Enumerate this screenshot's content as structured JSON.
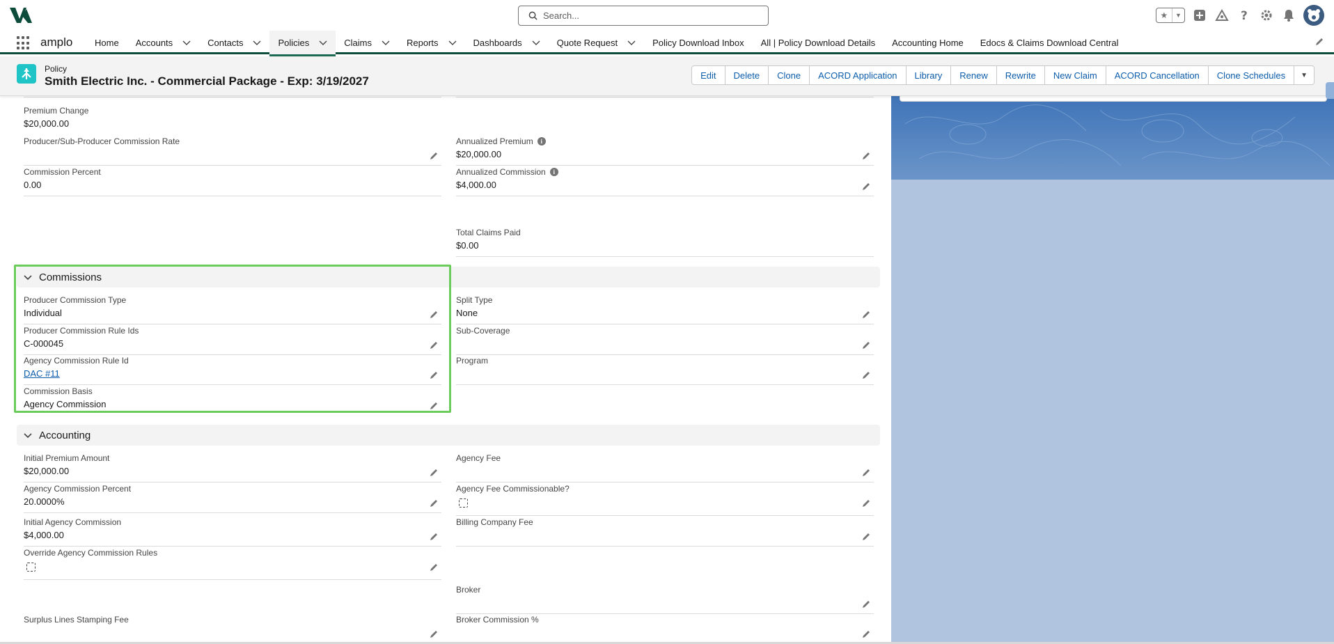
{
  "global_header": {
    "search_placeholder": "Search..."
  },
  "app": {
    "name": "amplo"
  },
  "nav": {
    "items": [
      {
        "label": "Home",
        "has_menu": false
      },
      {
        "label": "Accounts",
        "has_menu": true
      },
      {
        "label": "Contacts",
        "has_menu": true
      },
      {
        "label": "Policies",
        "has_menu": true,
        "active": true
      },
      {
        "label": "Claims",
        "has_menu": true
      },
      {
        "label": "Reports",
        "has_menu": true
      },
      {
        "label": "Dashboards",
        "has_menu": true
      },
      {
        "label": "Quote Request",
        "has_menu": true
      },
      {
        "label": "Policy Download Inbox",
        "has_menu": false
      },
      {
        "label": "All | Policy Download Details",
        "has_menu": false
      },
      {
        "label": "Accounting Home",
        "has_menu": false
      },
      {
        "label": "Edocs & Claims Download Central",
        "has_menu": false
      }
    ]
  },
  "record": {
    "type": "Policy",
    "title": "Smith Electric Inc. - Commercial Package - Exp: 3/19/2027"
  },
  "actions": [
    "Edit",
    "Delete",
    "Clone",
    "ACORD Application",
    "Library",
    "Renew",
    "Rewrite",
    "New Claim",
    "ACORD Cancellation",
    "Clone Schedules"
  ],
  "top_fields": {
    "premium_change": {
      "label": "Premium Change",
      "value": "$20,000.00"
    },
    "producer_rate": {
      "label": "Producer/Sub-Producer Commission Rate",
      "value": ""
    },
    "annualized_premium": {
      "label": "Annualized Premium",
      "value": "$20,000.00"
    },
    "commission_percent": {
      "label": "Commission Percent",
      "value": "0.00"
    },
    "annualized_commission": {
      "label": "Annualized Commission",
      "value": "$4,000.00"
    },
    "total_claims_paid": {
      "label": "Total Claims Paid",
      "value": "$0.00"
    }
  },
  "commissions": {
    "title": "Commissions",
    "producer_commission_type": {
      "label": "Producer Commission Type",
      "value": "Individual"
    },
    "split_type": {
      "label": "Split Type",
      "value": "None"
    },
    "producer_rule_ids": {
      "label": "Producer Commission Rule Ids",
      "value": "C-000045"
    },
    "sub_coverage": {
      "label": "Sub-Coverage",
      "value": ""
    },
    "agency_rule_id": {
      "label": "Agency Commission Rule Id",
      "value": "DAC #11"
    },
    "program": {
      "label": "Program",
      "value": ""
    },
    "commission_basis": {
      "label": "Commission Basis",
      "value": "Agency Commission"
    }
  },
  "accounting": {
    "title": "Accounting",
    "initial_premium": {
      "label": "Initial Premium Amount",
      "value": "$20,000.00"
    },
    "agency_fee": {
      "label": "Agency Fee",
      "value": ""
    },
    "agency_commission_percent": {
      "label": "Agency Commission Percent",
      "value": "20.0000%"
    },
    "agency_fee_commissionable": {
      "label": "Agency Fee Commissionable?",
      "checked": false
    },
    "initial_agency_commission": {
      "label": "Initial Agency Commission",
      "value": "$4,000.00"
    },
    "billing_company_fee": {
      "label": "Billing Company Fee",
      "value": ""
    },
    "override_rules": {
      "label": "Override Agency Commission Rules",
      "checked": false
    },
    "broker": {
      "label": "Broker",
      "value": ""
    },
    "surplus_stamping_fee": {
      "label": "Surplus Lines Stamping Fee",
      "value": ""
    },
    "broker_commission": {
      "label": "Broker Commission %",
      "value": ""
    }
  },
  "colors": {
    "brand_dark": "#0d4c3a",
    "link_blue": "#0b5cab",
    "highlight_green": "#6bcb5b"
  }
}
